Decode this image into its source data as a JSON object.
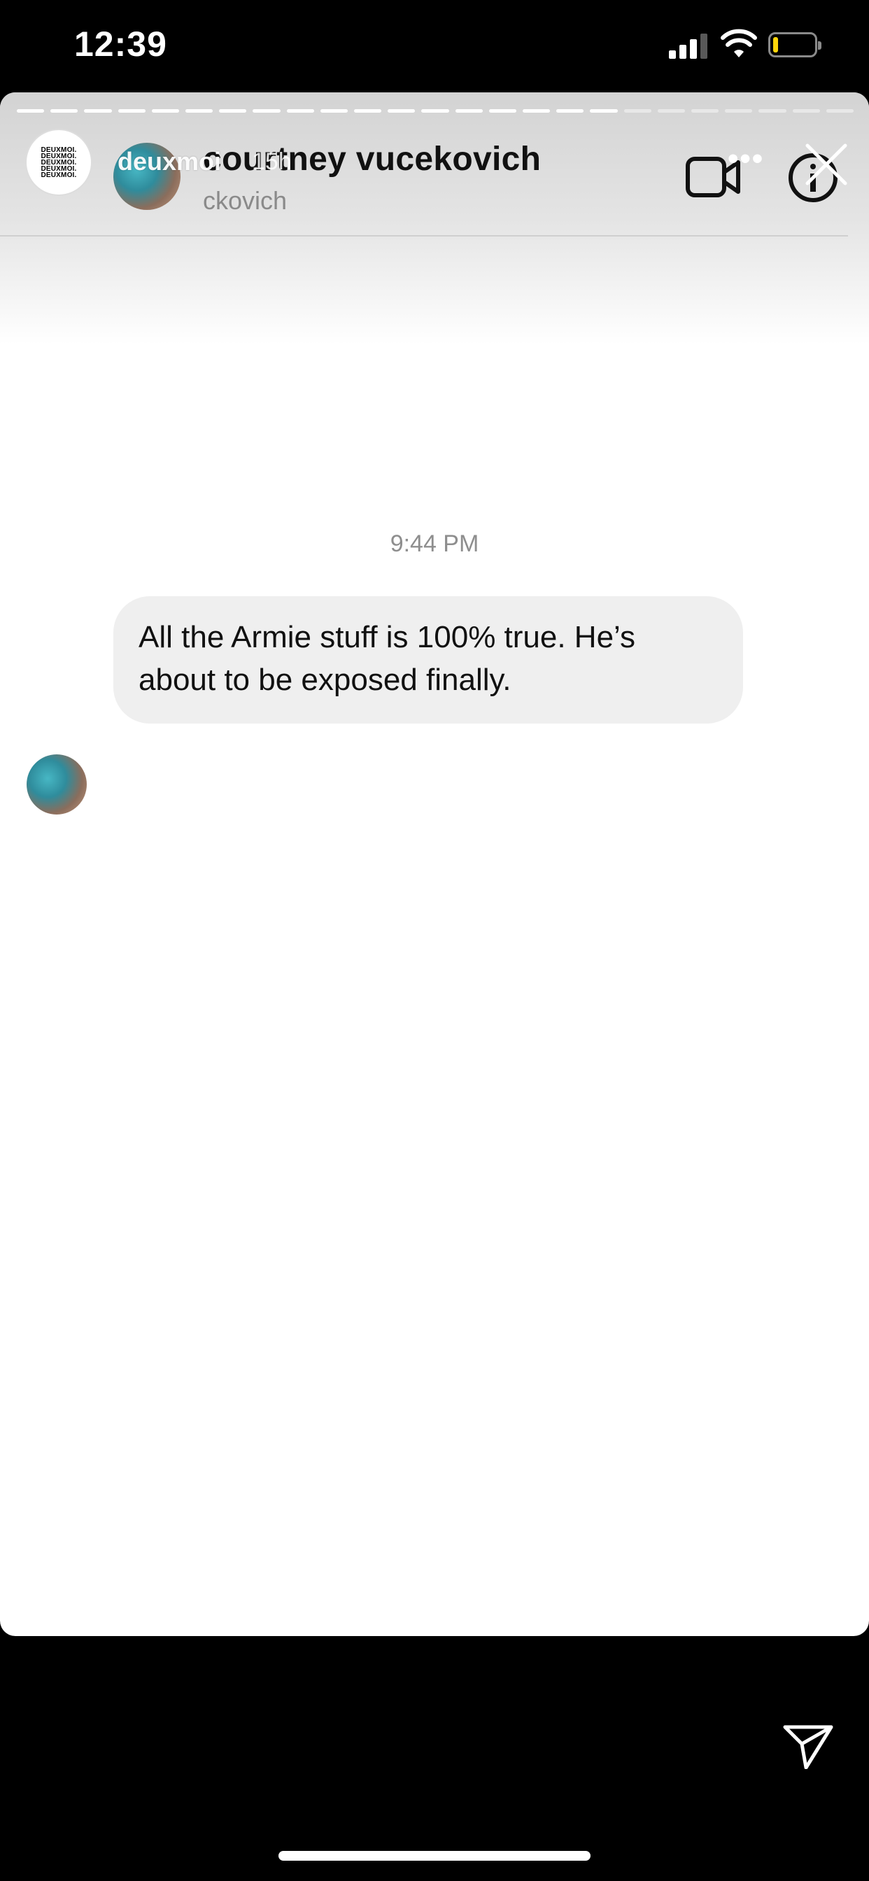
{
  "status_bar": {
    "time": "12:39",
    "battery_level": 0.12
  },
  "story": {
    "progress": {
      "total_segments": 25,
      "completed_segments": 18
    },
    "owner": {
      "avatar_text": [
        "DEUXMOI.",
        "DEUXMOI.",
        "DEUXMOI.",
        "DEUXMOI.",
        "DEUXMOI."
      ],
      "username": "deuxmoi",
      "time_ago": "15h"
    },
    "more_label": "•••"
  },
  "chat": {
    "contact_name": "courtney vucekovich",
    "contact_handle": "ckovich",
    "timestamp": "9:44 PM",
    "message": "All the Armie stuff is 100% true. He’s about to be exposed finally."
  },
  "colors": {
    "background": "#000000",
    "card": "#ffffff",
    "bubble": "#efefef",
    "battery_fill": "#ffd60a"
  }
}
